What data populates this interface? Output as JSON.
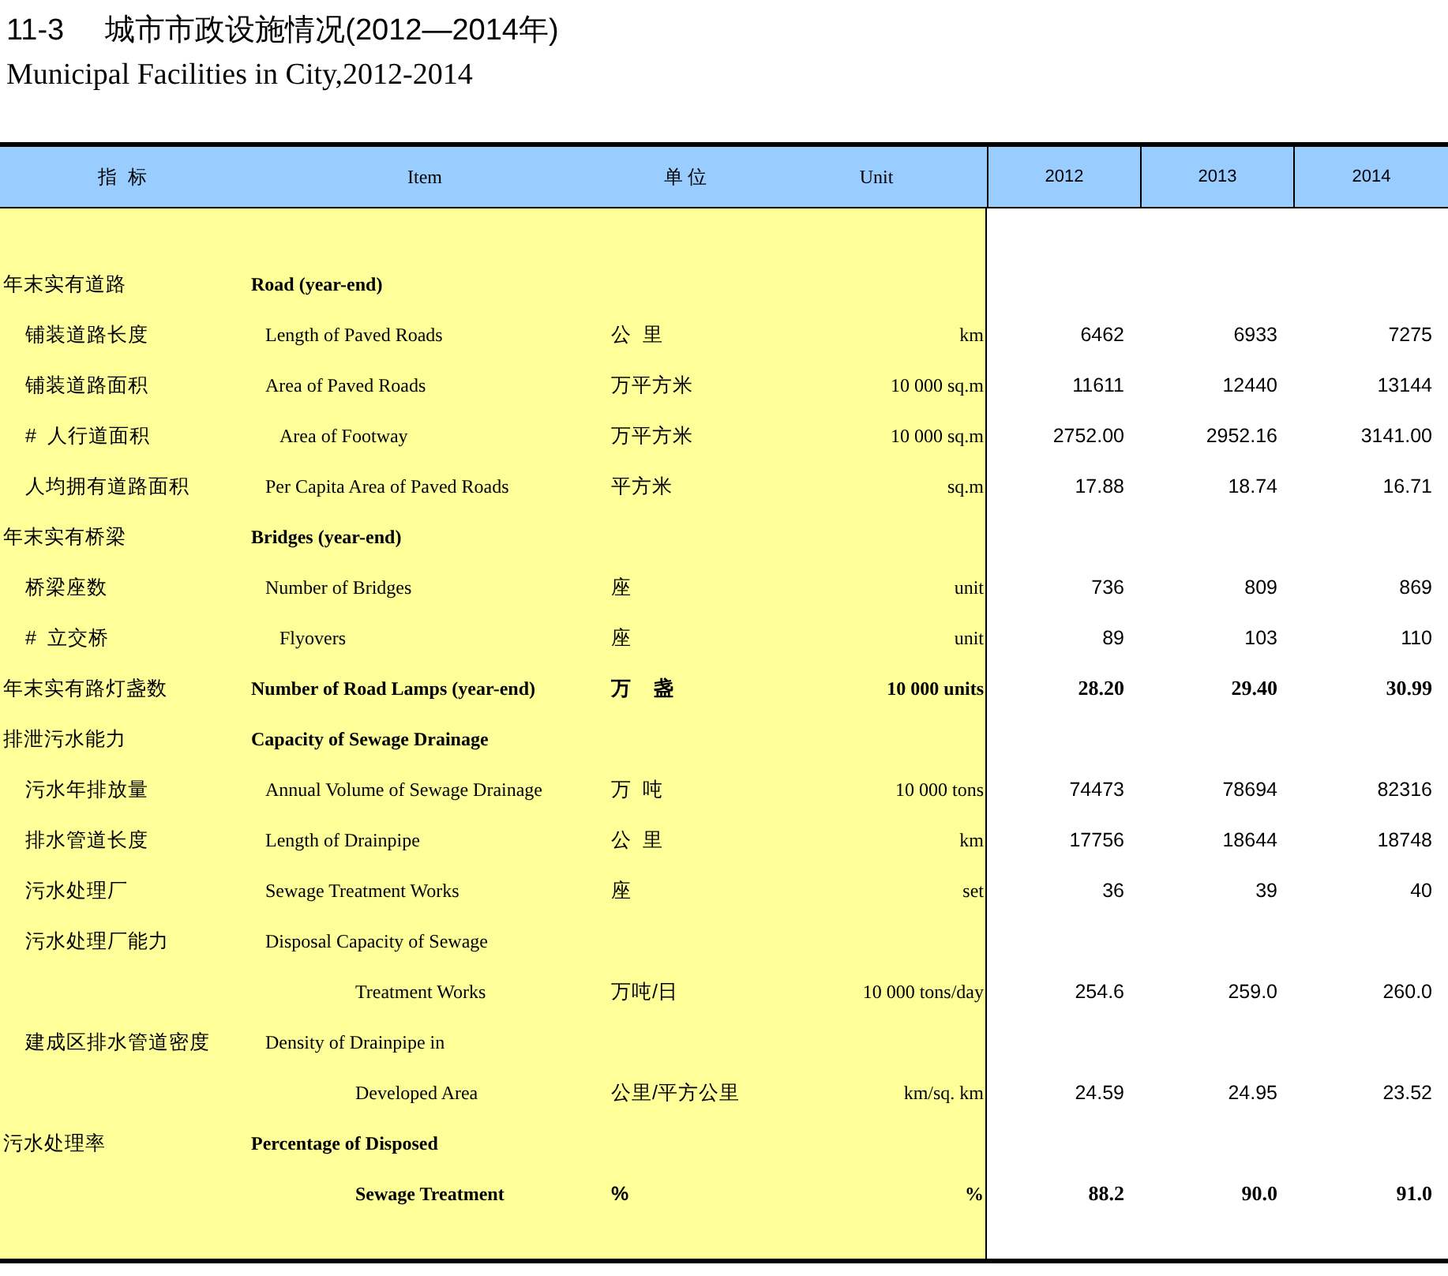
{
  "title": {
    "number": "11-3",
    "text": "城市市政设施情况(2012—2014年)",
    "subtitle": "Municipal Facilities in City,2012-2014"
  },
  "table": {
    "columns": [
      "指  标",
      "Item",
      "单 位",
      "Unit",
      "2012",
      "2013",
      "2014"
    ],
    "rows": [
      {
        "kind": "category",
        "bold": true,
        "zh": "年末实有道路",
        "en": "Road (year-end)"
      },
      {
        "kind": "item",
        "bold": false,
        "zh": "铺装道路长度",
        "en": "Length of Paved Roads",
        "unit_zh": "公  里",
        "unit_en": "km",
        "values": [
          "6462",
          "6933",
          "7275"
        ]
      },
      {
        "kind": "item",
        "bold": false,
        "zh": "铺装道路面积",
        "en": "Area of Paved Roads",
        "unit_zh": "万平方米",
        "unit_en": "10 000 sq.m",
        "values": [
          "11611",
          "12440",
          "13144"
        ]
      },
      {
        "kind": "sub_item",
        "bold": false,
        "zh": "#  人行道面积",
        "en": "Area of Footway",
        "unit_zh": "万平方米",
        "unit_en": "10 000 sq.m",
        "values": [
          "2752.00",
          "2952.16",
          "3141.00"
        ]
      },
      {
        "kind": "item",
        "bold": false,
        "zh": "人均拥有道路面积",
        "en": "Per Capita Area of Paved Roads",
        "unit_zh": "平方米",
        "unit_en": "sq.m",
        "values": [
          "17.88",
          "18.74",
          "16.71"
        ]
      },
      {
        "kind": "category",
        "bold": true,
        "zh": "年末实有桥梁",
        "en": "Bridges (year-end)"
      },
      {
        "kind": "item",
        "bold": false,
        "zh": "桥梁座数",
        "en": "Number of Bridges",
        "unit_zh": "座",
        "unit_en": "unit",
        "values": [
          "736",
          "809",
          "869"
        ]
      },
      {
        "kind": "sub_item",
        "bold": false,
        "zh": "#  立交桥",
        "en": "Flyovers",
        "unit_zh": "座",
        "unit_en": "unit",
        "values": [
          "89",
          "103",
          "110"
        ]
      },
      {
        "kind": "category",
        "bold": true,
        "zh": "年末实有路灯盏数",
        "en": "Number of Road Lamps (year-end)",
        "unit_zh": "万    盏",
        "unit_en": "10 000 units",
        "values": [
          "28.20",
          "29.40",
          "30.99"
        ]
      },
      {
        "kind": "category",
        "bold": true,
        "zh": "排泄污水能力",
        "en": "Capacity of Sewage Drainage"
      },
      {
        "kind": "item",
        "bold": false,
        "zh": "污水年排放量",
        "en": "Annual Volume of Sewage Drainage",
        "unit_zh": "万  吨",
        "unit_en": "10 000 tons",
        "values": [
          "74473",
          "78694",
          "82316"
        ]
      },
      {
        "kind": "item",
        "bold": false,
        "zh": "排水管道长度",
        "en": "Length of Drainpipe",
        "unit_zh": "公  里",
        "unit_en": "km",
        "values": [
          "17756",
          "18644",
          "18748"
        ]
      },
      {
        "kind": "item",
        "bold": false,
        "zh": "污水处理厂",
        "en": "Sewage Treatment Works",
        "unit_zh": "座",
        "unit_en": "set",
        "values": [
          "36",
          "39",
          "40"
        ]
      },
      {
        "kind": "item",
        "bold": false,
        "zh": "污水处理厂能力",
        "en": "Disposal Capacity of Sewage"
      },
      {
        "kind": "continuation",
        "bold": false,
        "en": "Treatment Works",
        "unit_zh": "万吨/日",
        "unit_en": "10 000 tons/day",
        "values": [
          "254.6",
          "259.0",
          "260.0"
        ]
      },
      {
        "kind": "item",
        "bold": false,
        "zh": "建成区排水管道密度",
        "en": "Density of Drainpipe in"
      },
      {
        "kind": "continuation",
        "bold": false,
        "en": "Developed Area",
        "unit_zh": "公里/平方公里",
        "unit_en": "km/sq. km",
        "values": [
          "24.59",
          "24.95",
          "23.52"
        ]
      },
      {
        "kind": "category",
        "bold": true,
        "zh": "污水处理率",
        "en": "Percentage of Disposed"
      },
      {
        "kind": "continuation",
        "bold": true,
        "en": "Sewage Treatment",
        "unit_zh": "%",
        "unit_en": "%",
        "values": [
          "88.2",
          "90.0",
          "91.0"
        ]
      }
    ]
  }
}
